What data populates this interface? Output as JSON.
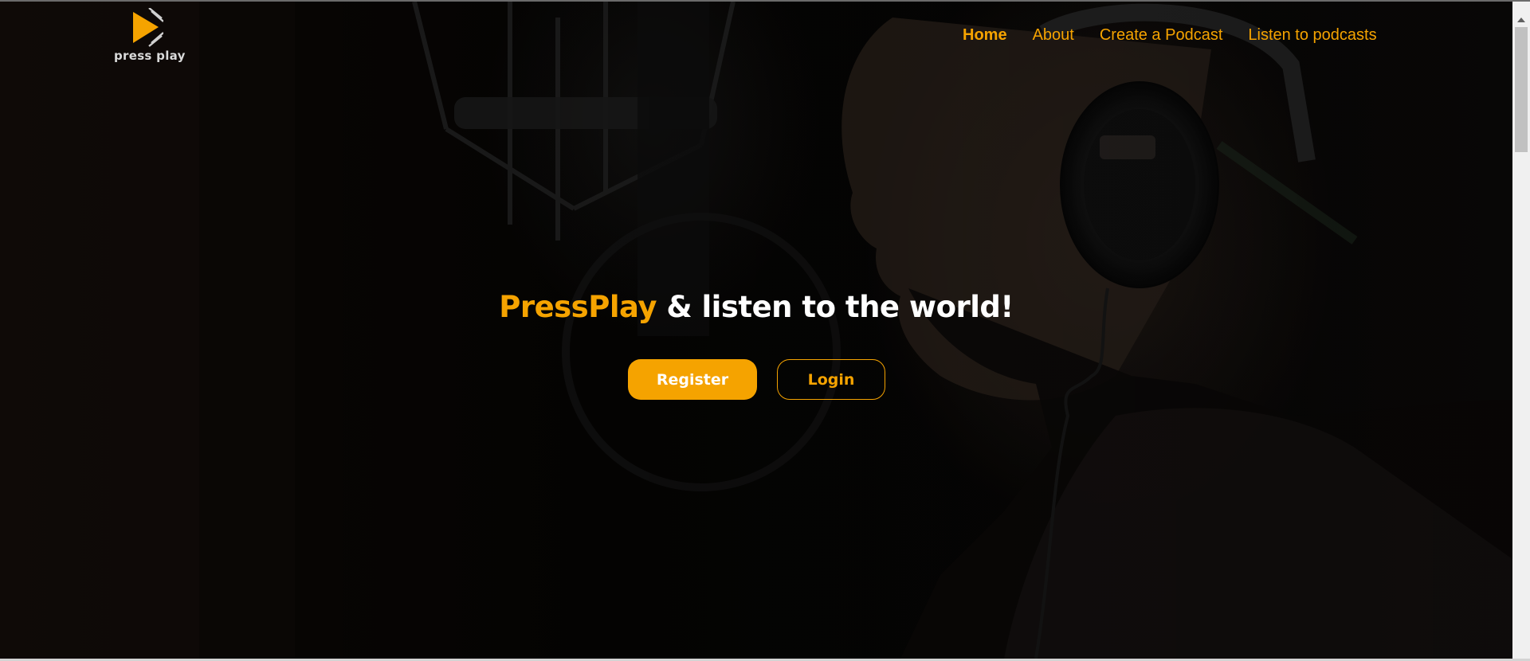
{
  "brand": {
    "logo_text": "press play",
    "logo_icon": "play-triangle-icon",
    "accent_color": "#f5a300"
  },
  "nav": {
    "items": [
      {
        "label": "Home",
        "active": true
      },
      {
        "label": "About",
        "active": false
      },
      {
        "label": "Create a Podcast",
        "active": false
      },
      {
        "label": "Listen to podcasts",
        "active": false
      }
    ]
  },
  "hero": {
    "headline_brand": "PressPlay",
    "headline_rest": " & listen to the world!",
    "register_label": "Register",
    "login_label": "Login"
  }
}
